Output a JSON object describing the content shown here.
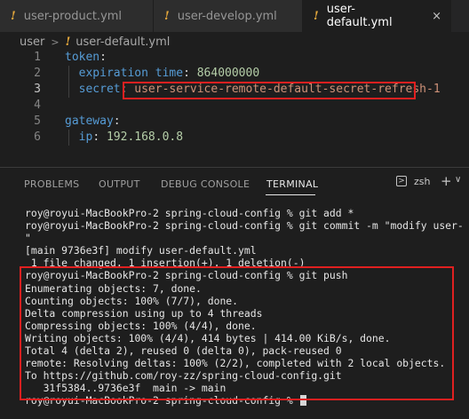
{
  "tabs": [
    {
      "label": "user-product.yml",
      "icon": "yaml-exclamation-icon"
    },
    {
      "label": "user-develop.yml",
      "icon": "yaml-exclamation-icon"
    },
    {
      "label": "user-default.yml",
      "icon": "yaml-exclamation-icon",
      "active": true,
      "close": "×"
    }
  ],
  "breadcrumb": {
    "folder": "user",
    "file": "user-default.yml"
  },
  "editor": {
    "lines": [
      {
        "num": "1",
        "key": "token",
        "colon": ":"
      },
      {
        "num": "2",
        "key": "expiration time",
        "colon": ": ",
        "value": "864000000"
      },
      {
        "num": "3",
        "key": "secret",
        "colon": ": ",
        "value": "user-service-remote-default-secret-refresh-1"
      },
      {
        "num": "4"
      },
      {
        "num": "5",
        "key": "gateway",
        "colon": ":"
      },
      {
        "num": "6",
        "key": "ip",
        "colon": ": ",
        "value": "192.168.0.8"
      }
    ]
  },
  "panel": {
    "tabs": [
      "PROBLEMS",
      "OUTPUT",
      "DEBUG CONSOLE",
      "TERMINAL"
    ],
    "active_tab": "TERMINAL",
    "shell": "zsh",
    "plus": "+",
    "chevron": "∨"
  },
  "terminal": {
    "lines": [
      "roy@royui-MacBookPro-2 spring-cloud-config % git add *",
      "roy@royui-MacBookPro-2 spring-cloud-config % git commit -m \"modify user-",
      "\"",
      "[main 9736e3f] modify user-default.yml",
      " 1 file changed, 1 insertion(+), 1 deletion(-)",
      "roy@royui-MacBookPro-2 spring-cloud-config % git push",
      "Enumerating objects: 7, done.",
      "Counting objects: 100% (7/7), done.",
      "Delta compression using up to 4 threads",
      "Compressing objects: 100% (4/4), done.",
      "Writing objects: 100% (4/4), 414 bytes | 414.00 KiB/s, done.",
      "Total 4 (delta 2), reused 0 (delta 0), pack-reused 0",
      "remote: Resolving deltas: 100% (2/2), completed with 2 local objects.",
      "To https://github.com/roy-zz/spring-cloud-config.git",
      "   31f5384..9736e3f  main -> main",
      "roy@royui-MacBookPro-2 spring-cloud-config % "
    ]
  },
  "colors": {
    "accent_warning": "#e8aa3c",
    "highlight_box": "#e02020",
    "yaml_key": "#569cd6",
    "yaml_string": "#ce9178",
    "yaml_number": "#b5cea8"
  }
}
